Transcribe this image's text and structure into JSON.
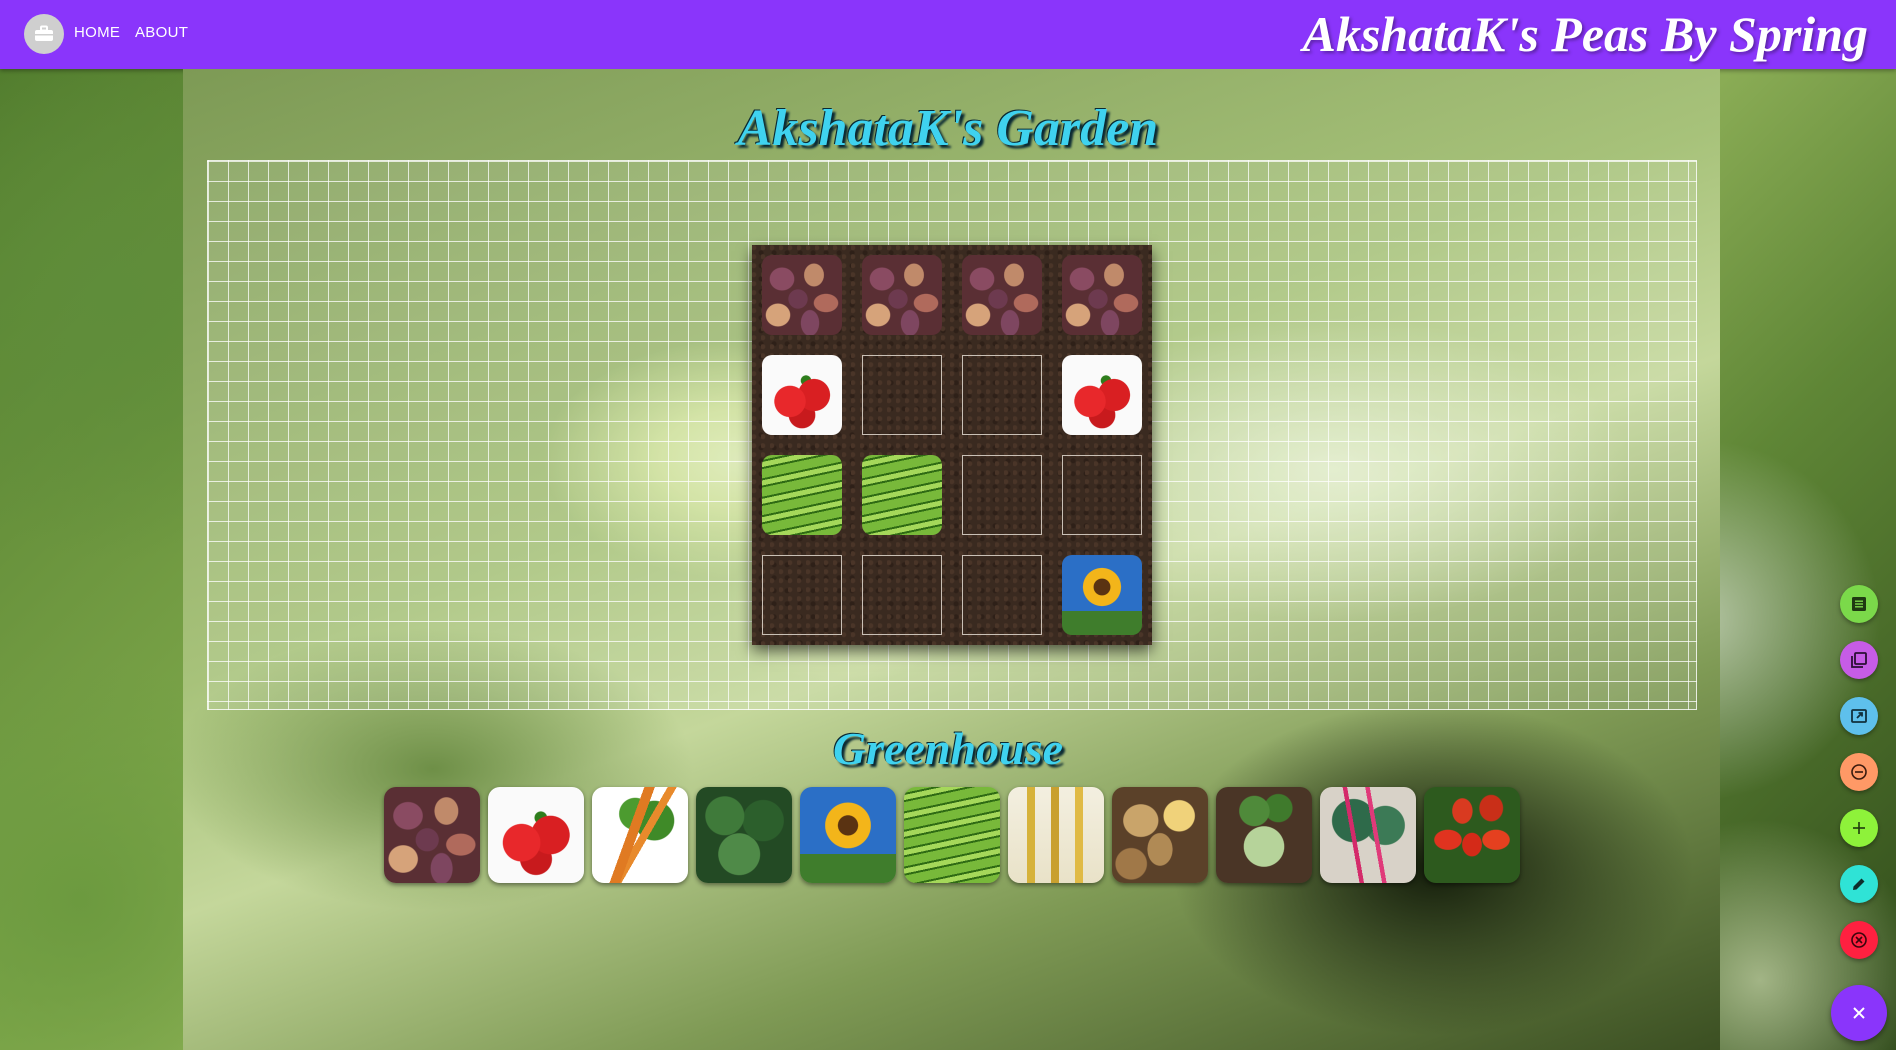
{
  "nav": {
    "home_label": "HOME",
    "about_label": "ABOUT",
    "brand": "AkshataK's Peas By Spring",
    "logo_icon": "briefcase-icon"
  },
  "garden": {
    "title": "AkshataK's Garden",
    "rows": 4,
    "cols": 4,
    "plots": [
      [
        "potato-purple",
        "potato-purple",
        "potato-purple",
        "potato-purple"
      ],
      [
        "tomato",
        "empty",
        "empty",
        "tomato"
      ],
      [
        "peas",
        "peas",
        "empty",
        "empty"
      ],
      [
        "empty",
        "empty",
        "empty",
        "sunflower"
      ]
    ]
  },
  "greenhouse": {
    "title": "Greenhouse",
    "items": [
      "potato-purple",
      "tomato",
      "carrot",
      "kale",
      "sunflower",
      "peas",
      "corn",
      "potato-gold",
      "kohlrabi",
      "chard",
      "roma-tomato"
    ]
  },
  "speed_dial": {
    "actions": [
      {
        "name": "list-icon",
        "color": "#7bd94a"
      },
      {
        "name": "copy-icon",
        "color": "#c65ce6"
      },
      {
        "name": "export-icon",
        "color": "#5ec0ec"
      },
      {
        "name": "remove-icon",
        "color": "#ff9966"
      },
      {
        "name": "add-icon",
        "color": "#8ef23a"
      },
      {
        "name": "edit-icon",
        "color": "#2fe3d6"
      },
      {
        "name": "delete-icon",
        "color": "#ff2040"
      }
    ],
    "main": {
      "name": "close-icon",
      "color": "#8a35fb"
    }
  },
  "colors": {
    "navbar": "#8a35fb",
    "title": "#3fd2ef"
  }
}
